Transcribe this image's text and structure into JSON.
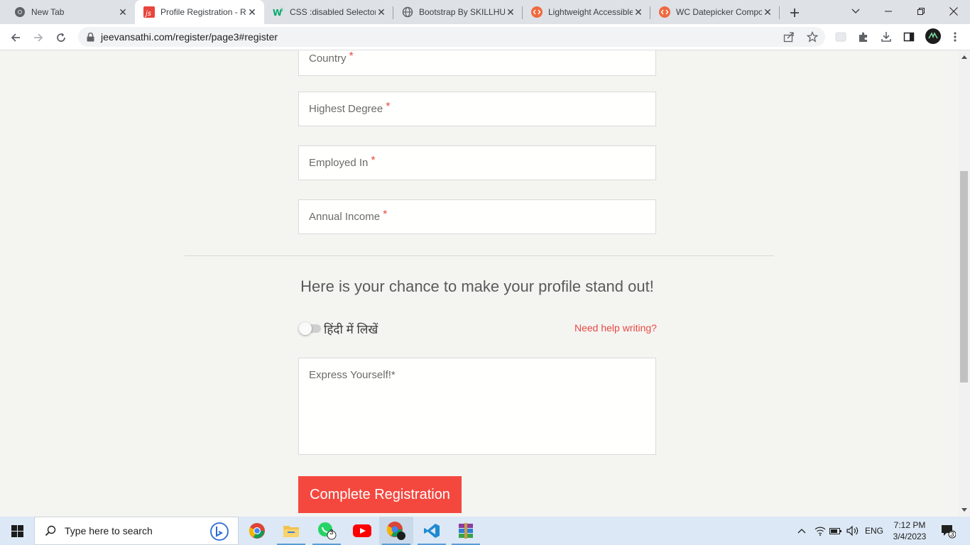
{
  "browser": {
    "tabs": [
      {
        "title": "New Tab",
        "icon": "chrome-icon",
        "active": false
      },
      {
        "title": "Profile Registration - R",
        "icon": "js-icon",
        "active": true
      },
      {
        "title": "CSS :disabled Selector",
        "icon": "w3schools-icon",
        "active": false
      },
      {
        "title": "Bootstrap By SKILLHUB",
        "icon": "globe-icon",
        "active": false
      },
      {
        "title": "Lightweight Accessible",
        "icon": "code-icon",
        "active": false
      },
      {
        "title": "WC Datepicker Compo",
        "icon": "code-icon",
        "active": false
      }
    ],
    "url": "jeevansathi.com/register/page3#register",
    "accent": "#1a73e8"
  },
  "form": {
    "fields": {
      "country": "Country",
      "highest_degree": "Highest Degree",
      "employed_in": "Employed In",
      "annual_income": "Annual Income"
    },
    "required_mark": "*",
    "standout_heading": "Here is your chance to make your profile stand out!",
    "hindi_toggle_label": "हिंदी में लिखें",
    "hindi_toggle_on": false,
    "help_link": "Need help writing?",
    "express_label": "Express Yourself!",
    "submit_label": "Complete Registration",
    "brand_color": "#f4483f"
  },
  "taskbar": {
    "search_placeholder": "Type here to search",
    "whatsapp_badge": "3",
    "language": "ENG",
    "time": "7:12 PM",
    "date": "3/4/2023",
    "notification_count": "3"
  }
}
